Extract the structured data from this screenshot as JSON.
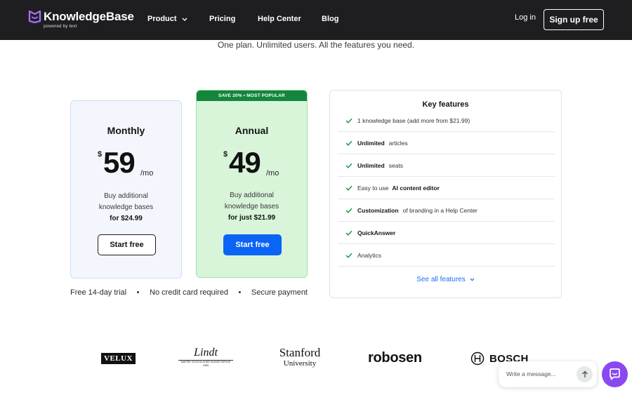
{
  "nav": {
    "brand_name": "KnowledgeBase",
    "brand_sub": "powered by text",
    "product": "Product",
    "pricing": "Pricing",
    "help_center": "Help Center",
    "blog": "Blog",
    "login": "Log in",
    "signup": "Sign up free"
  },
  "tagline": "One plan. Unlimited users. All the features you need.",
  "plans": {
    "monthly": {
      "name": "Monthly",
      "currency": "$",
      "amount": "59",
      "per": "/mo",
      "desc_line1": "Buy additional",
      "desc_line2": "knowledge bases",
      "desc_price": "for $24.99",
      "cta": "Start free"
    },
    "annual": {
      "ribbon": "SAVE 20% • MOST POPULAR",
      "name": "Annual",
      "currency": "$",
      "amount": "49",
      "per": "/mo",
      "desc_line1": "Buy additional",
      "desc_line2": "knowledge bases",
      "desc_price": "for just $21.99",
      "cta": "Start free"
    }
  },
  "trust": {
    "trial": "Free 14-day trial",
    "sep1": "•",
    "card": "No credit card required",
    "sep2": "•",
    "payment": "Secure payment"
  },
  "features": {
    "title": "Key features",
    "items": [
      {
        "bold": "",
        "text": "1 knowledge base (add more from $21.99)"
      },
      {
        "bold": "Unlimited",
        "text": "articles"
      },
      {
        "bold": "Unlimited",
        "text": "seats"
      },
      {
        "pre": "Easy to use",
        "bold": "AI content editor",
        "text": ""
      },
      {
        "bold": "Customization",
        "text": "of branding in a Help Center"
      },
      {
        "bold": "QuickAnswer",
        "text": ""
      },
      {
        "bold": "",
        "text": "Analytics"
      }
    ],
    "see_all": "See all features"
  },
  "logos": {
    "velux": "VELUX",
    "lindt": "Lindt",
    "lindt_sub": "MAÎTRE CHOCOLATIER SUISSE DEPUIS 1845",
    "stanford_1": "Stanford",
    "stanford_2": "University",
    "robosen": "robosen",
    "bosch": "BOSCH"
  },
  "chat": {
    "placeholder": "Write a message..."
  },
  "colors": {
    "nav_bg": "#1e1e21",
    "primary": "#0a64f5",
    "annual_bg": "#d8f5d9",
    "ribbon": "#14853d",
    "check": "#1c9a4a",
    "chat": "#8a48f0"
  }
}
